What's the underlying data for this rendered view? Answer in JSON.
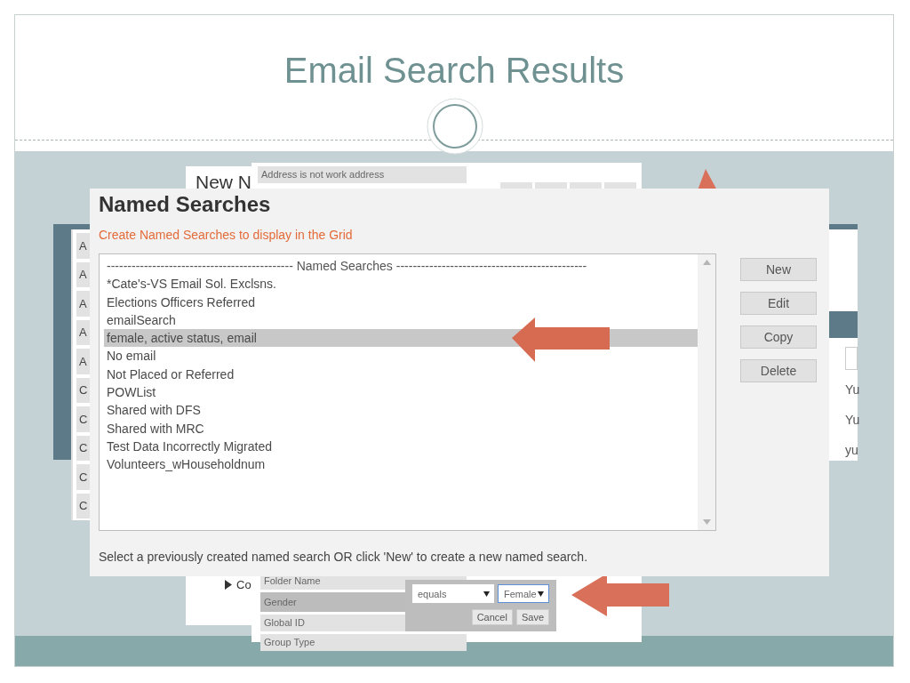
{
  "slide": {
    "title": "Email Search Results"
  },
  "grid_behind": {
    "row_letters": [
      "A",
      "A",
      "A",
      "A",
      "A",
      "C",
      "C",
      "C",
      "C",
      "C"
    ],
    "right_cells": [
      "Yu",
      "Yu",
      "yu"
    ]
  },
  "new_panel": {
    "title": "New N",
    "tree_items": [
      "Co"
    ]
  },
  "fields_panel": {
    "top_rows": [
      {
        "label": "Address is not work address",
        "selected": false
      }
    ],
    "bottom_rows": [
      {
        "label": "Folder Name",
        "selected": false
      },
      {
        "label": "Gender",
        "selected": true
      },
      {
        "label": "Global ID",
        "selected": false
      },
      {
        "label": "Group Type",
        "selected": false
      }
    ]
  },
  "condition_popover": {
    "operator": "equals",
    "value": "Female",
    "buttons": [
      "Cancel",
      "Save"
    ]
  },
  "dialog": {
    "title": "Named Searches",
    "subtitle": "Create Named Searches to display in the Grid",
    "list_header": "--------------------------------------------- Named Searches ----------------------------------------------",
    "items": [
      {
        "label": "*Cate's-VS Email Sol. Exclsns.",
        "selected": false
      },
      {
        "label": "Elections Officers Referred",
        "selected": false
      },
      {
        "label": "emailSearch",
        "selected": false
      },
      {
        "label": "female, active status, email",
        "selected": true
      },
      {
        "label": "No email",
        "selected": false
      },
      {
        "label": "Not Placed or Referred",
        "selected": false
      },
      {
        "label": "POWList",
        "selected": false
      },
      {
        "label": "Shared with DFS",
        "selected": false
      },
      {
        "label": "Shared with MRC",
        "selected": false
      },
      {
        "label": "Test Data Incorrectly Migrated",
        "selected": false
      },
      {
        "label": "Volunteers_wHouseholdnum",
        "selected": false
      }
    ],
    "buttons": [
      "New",
      "Edit",
      "Copy",
      "Delete"
    ],
    "footer": "Select a previously created named search OR click 'New' to create a new named search."
  }
}
